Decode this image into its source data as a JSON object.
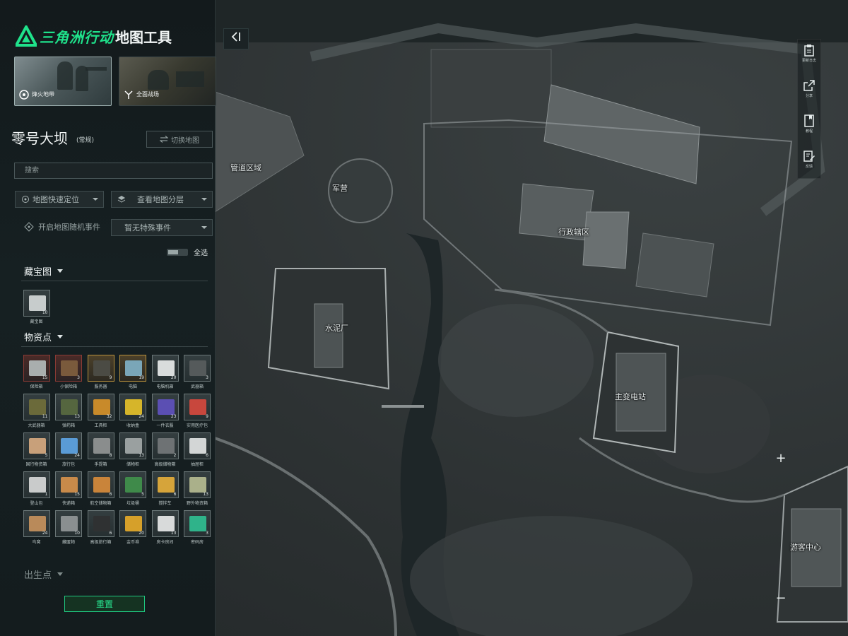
{
  "brand": {
    "title_green": "三角洲行动",
    "title_white": "地图工具",
    "accent": "#1fe28b"
  },
  "modes": [
    {
      "label": "烽火地带",
      "selected": true
    },
    {
      "label": "全面战场",
      "selected": false
    }
  ],
  "map": {
    "name": "零号大坝",
    "mode": "(常规)",
    "switch_label": "切换地图",
    "labels": [
      "管道区域",
      "军营",
      "行政辖区",
      "水泥厂",
      "主变电站",
      "游客中心"
    ]
  },
  "search": {
    "placeholder": "搜索",
    "value": ""
  },
  "controls": {
    "quick_locate": "地图快速定位",
    "view_layers": "查看地图分层",
    "random_event": "开启地图随机事件",
    "no_event": "暂无特殊事件",
    "select_all": "全选"
  },
  "categories": {
    "treasure": {
      "title": "藏宝图",
      "items": [
        {
          "label": "藏宝图",
          "count": "10"
        }
      ]
    },
    "supplies": {
      "title": "物资点",
      "items": [
        {
          "label": "保险箱",
          "count": "15",
          "tone": "red",
          "color": "#a9aeae"
        },
        {
          "label": "小保险箱",
          "count": "3",
          "tone": "red",
          "color": "#7a5a3c"
        },
        {
          "label": "服务器",
          "count": "9",
          "tone": "gold",
          "color": "#4b4b44"
        },
        {
          "label": "电脑",
          "count": "19",
          "tone": "gold",
          "color": "#7aa6b8"
        },
        {
          "label": "电脑机箱",
          "count": "20",
          "tone": "",
          "color": "#d9dcdc"
        },
        {
          "label": "武器箱",
          "count": "3",
          "tone": "",
          "color": "#555a5b"
        },
        {
          "label": "大武器箱",
          "count": "11",
          "tone": "",
          "color": "#6b6a3a"
        },
        {
          "label": "弹药箱",
          "count": "13",
          "tone": "",
          "color": "#55663f"
        },
        {
          "label": "工具柜",
          "count": "32",
          "tone": "",
          "color": "#c88a2a"
        },
        {
          "label": "收纳盒",
          "count": "24",
          "tone": "",
          "color": "#d6b52a"
        },
        {
          "label": "一件衣服",
          "count": "23",
          "tone": "",
          "color": "#5b4fb3"
        },
        {
          "label": "实用医疗包",
          "count": "9",
          "tone": "",
          "color": "#c8473d"
        },
        {
          "label": "国行物资箱",
          "count": "5",
          "tone": "",
          "color": "#c8a07a"
        },
        {
          "label": "旅行包",
          "count": "24",
          "tone": "",
          "color": "#5a9bd6"
        },
        {
          "label": "手提箱",
          "count": "8",
          "tone": "",
          "color": "#8a8d8d"
        },
        {
          "label": "储物柜",
          "count": "13",
          "tone": "",
          "color": "#9aa0a0"
        },
        {
          "label": "高级储物箱",
          "count": "2",
          "tone": "",
          "color": "#6e7274"
        },
        {
          "label": "抽屉柜",
          "count": "6",
          "tone": "",
          "color": "#d3d6d6"
        },
        {
          "label": "登山包",
          "count": "1",
          "tone": "",
          "color": "#c9cbcb"
        },
        {
          "label": "快递箱",
          "count": "15",
          "tone": "",
          "color": "#c88a4a"
        },
        {
          "label": "航空储物箱",
          "count": "6",
          "tone": "",
          "color": "#c9843a"
        },
        {
          "label": "垃圾桶",
          "count": "5",
          "tone": "",
          "color": "#3f8a4a"
        },
        {
          "label": "搅拌车",
          "count": "6",
          "tone": "",
          "color": "#d6a43a"
        },
        {
          "label": "野外物资箱",
          "count": "13",
          "tone": "",
          "color": "#aab08a"
        },
        {
          "label": "鸟窝",
          "count": "24",
          "tone": "",
          "color": "#b98a5a"
        },
        {
          "label": "藏匿物",
          "count": "10",
          "tone": "",
          "color": "#8a8f90"
        },
        {
          "label": "高级旅行箱",
          "count": "6",
          "tone": "",
          "color": "#2f3132"
        },
        {
          "label": "金币堆",
          "count": "20",
          "tone": "",
          "color": "#d6a02a"
        },
        {
          "label": "房卡房间",
          "count": "13",
          "tone": "",
          "color": "#d8dada"
        },
        {
          "label": "密码房",
          "count": "3",
          "tone": "",
          "color": "#2fb38a"
        }
      ]
    },
    "spawn": {
      "title": "出生点"
    }
  },
  "reset_label": "重置",
  "toolbar": [
    {
      "label": "更新日志",
      "icon": "clipboard-icon"
    },
    {
      "label": "分享",
      "icon": "share-icon"
    },
    {
      "label": "教程",
      "icon": "book-icon"
    },
    {
      "label": "反馈",
      "icon": "edit-icon"
    }
  ],
  "zoom": {
    "in": "+",
    "out": "−"
  }
}
